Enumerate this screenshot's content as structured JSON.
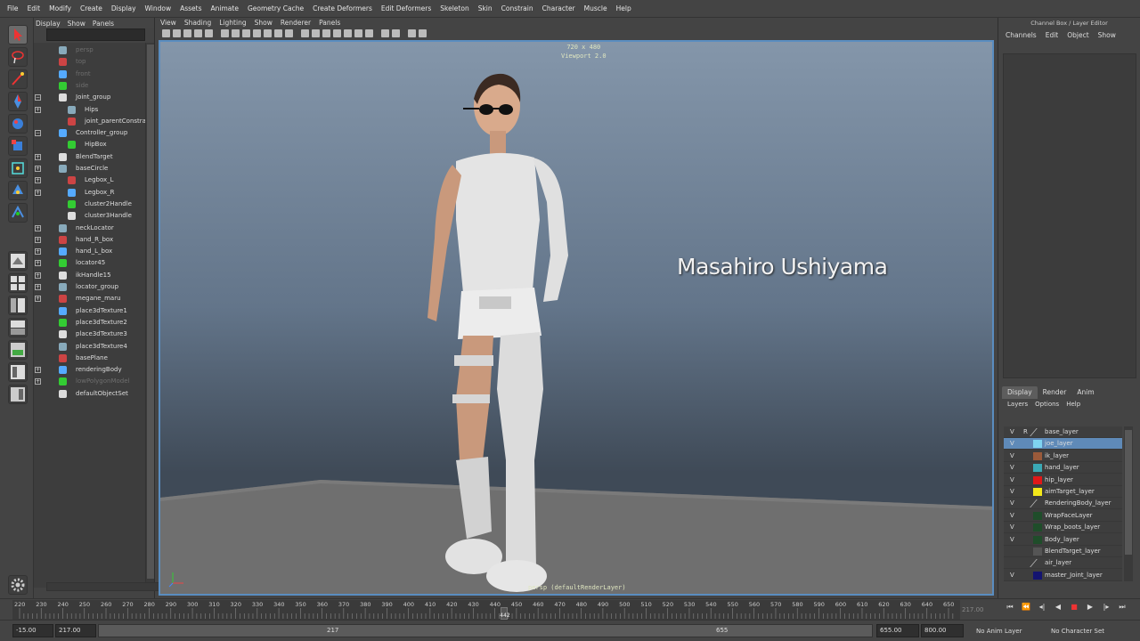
{
  "menubar": [
    "File",
    "Edit",
    "Modify",
    "Create",
    "Display",
    "Window",
    "Assets",
    "Animate",
    "Geometry Cache",
    "Create Deformers",
    "Edit Deformers",
    "Skeleton",
    "Skin",
    "Constrain",
    "Character",
    "Muscle",
    "Help"
  ],
  "outliner": {
    "menu": [
      "Display",
      "Show",
      "Panels"
    ],
    "items": [
      {
        "label": "persp",
        "dim": true,
        "expand": ""
      },
      {
        "label": "top",
        "dim": true,
        "expand": ""
      },
      {
        "label": "front",
        "dim": true,
        "expand": ""
      },
      {
        "label": "side",
        "dim": true,
        "expand": ""
      },
      {
        "label": "Joint_group",
        "dim": false,
        "expand": "−"
      },
      {
        "label": "Hips",
        "dim": false,
        "expand": "+"
      },
      {
        "label": "joint_parentConstraint",
        "dim": false,
        "expand": ""
      },
      {
        "label": "Controller_group",
        "dim": false,
        "expand": "−"
      },
      {
        "label": "HipBox",
        "dim": false,
        "expand": ""
      },
      {
        "label": "BlendTarget",
        "dim": false,
        "expand": "+"
      },
      {
        "label": "baseCircle",
        "dim": false,
        "expand": "+"
      },
      {
        "label": "Legbox_L",
        "dim": false,
        "expand": "+"
      },
      {
        "label": "Legbox_R",
        "dim": false,
        "expand": "+"
      },
      {
        "label": "cluster2Handle",
        "dim": false,
        "expand": ""
      },
      {
        "label": "cluster3Handle",
        "dim": false,
        "expand": ""
      },
      {
        "label": "neckLocator",
        "dim": false,
        "expand": "+"
      },
      {
        "label": "hand_R_box",
        "dim": false,
        "expand": "+"
      },
      {
        "label": "hand_L_box",
        "dim": false,
        "expand": "+"
      },
      {
        "label": "locator45",
        "dim": false,
        "expand": "+"
      },
      {
        "label": "ikHandle15",
        "dim": false,
        "expand": "+"
      },
      {
        "label": "locator_group",
        "dim": false,
        "expand": "+"
      },
      {
        "label": "megane_maru",
        "dim": false,
        "expand": "+"
      },
      {
        "label": "place3dTexture1",
        "dim": false,
        "expand": ""
      },
      {
        "label": "place3dTexture2",
        "dim": false,
        "expand": ""
      },
      {
        "label": "place3dTexture3",
        "dim": false,
        "expand": ""
      },
      {
        "label": "place3dTexture4",
        "dim": false,
        "expand": ""
      },
      {
        "label": "basePlane",
        "dim": false,
        "expand": ""
      },
      {
        "label": "renderingBody",
        "dim": false,
        "expand": "+"
      },
      {
        "label": "lowPolygonModel",
        "dim": true,
        "expand": "+"
      },
      {
        "label": "defaultObjectSet",
        "dim": false,
        "expand": ""
      }
    ]
  },
  "viewport": {
    "menu": [
      "View",
      "Shading",
      "Lighting",
      "Show",
      "Renderer",
      "Panels"
    ],
    "resolution": "720 x 480",
    "renderer": "Viewport 2.0",
    "camera": "persp (defaultRenderLayer)",
    "overlay_text": "Masahiro Ushiyama",
    "highlight_color": "#5a8dc0"
  },
  "right_panel": {
    "title": "Channel Box / Layer Editor",
    "tabs": [
      "Channels",
      "Edit",
      "Object",
      "Show"
    ],
    "layer_tabs": [
      "Display",
      "Render",
      "Anim"
    ],
    "layer_menu": [
      "Layers",
      "Options",
      "Help"
    ],
    "layers": [
      {
        "v": "V",
        "r": "R",
        "color": "",
        "name": "base_layer",
        "selected": false
      },
      {
        "v": "V",
        "r": "",
        "color": "#7fd4f0",
        "name": "joe_layer",
        "selected": true
      },
      {
        "v": "V",
        "r": "",
        "color": "#9a5a3a",
        "name": "ik_layer",
        "selected": false
      },
      {
        "v": "V",
        "r": "",
        "color": "#3aa9b5",
        "name": "hand_layer",
        "selected": false
      },
      {
        "v": "V",
        "r": "",
        "color": "#e01818",
        "name": "hip_layer",
        "selected": false
      },
      {
        "v": "V",
        "r": "",
        "color": "#f3e81a",
        "name": "aimTarget_layer",
        "selected": false
      },
      {
        "v": "V",
        "r": "",
        "color": "",
        "name": "RenderingBody_layer",
        "selected": false
      },
      {
        "v": "V",
        "r": "",
        "color": "#1f4d2a",
        "name": "WrapFaceLayer",
        "selected": false
      },
      {
        "v": "V",
        "r": "",
        "color": "#1f4d2a",
        "name": "Wrap_boots_layer",
        "selected": false
      },
      {
        "v": "V",
        "r": "",
        "color": "#1f4d2a",
        "name": "Body_layer",
        "selected": false
      },
      {
        "v": "",
        "r": "",
        "color": "#555555",
        "name": "BlendTarget_layer",
        "selected": false
      },
      {
        "v": "",
        "r": "",
        "color": "",
        "name": "air_layer",
        "selected": false
      },
      {
        "v": "V",
        "r": "",
        "color": "#141470",
        "name": "master_Joint_layer",
        "selected": false
      }
    ]
  },
  "timeline": {
    "ticks": [
      "220",
      "230",
      "240",
      "250",
      "260",
      "270",
      "280",
      "290",
      "300",
      "310",
      "320",
      "330",
      "340",
      "350",
      "360",
      "370",
      "380",
      "390",
      "400",
      "410",
      "420",
      "430",
      "440",
      "450",
      "460",
      "470",
      "480",
      "490",
      "500",
      "510",
      "520",
      "530",
      "540",
      "550",
      "560",
      "570",
      "580",
      "590",
      "600",
      "610",
      "620",
      "630",
      "640",
      "650"
    ],
    "current_frame": "442",
    "end_frame": "217.00"
  },
  "range": {
    "start": "-15.00",
    "start2": "217.00",
    "range_a": "217",
    "range_b": "655",
    "end": "655.00",
    "end2": "800.00",
    "anim_layer": "No Anim Layer",
    "character_set": "No Character Set"
  }
}
